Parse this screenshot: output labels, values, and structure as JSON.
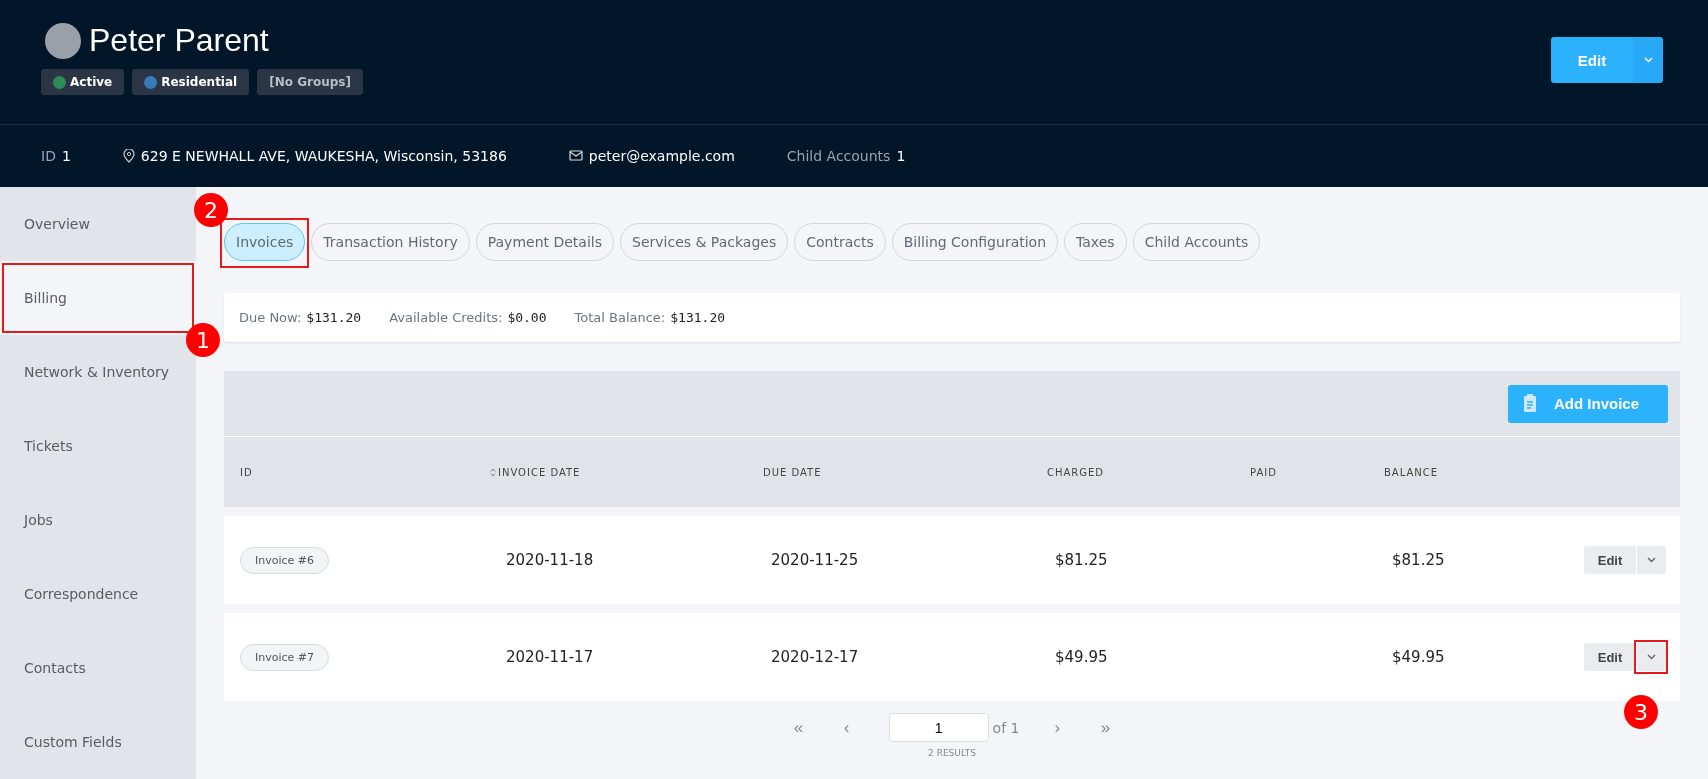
{
  "customer": {
    "name": "Peter Parent",
    "badges": [
      {
        "label": "Active",
        "color": "#2e8b57"
      },
      {
        "label": "Residential",
        "color": "#3a7ab8"
      },
      {
        "label": "[No Groups]"
      }
    ],
    "edit_button": "Edit"
  },
  "info_bar": {
    "id_label": "ID",
    "id_value": "1",
    "address": "629 E NEWHALL AVE, WAUKESHA, Wisconsin, 53186",
    "email": "peter@example.com",
    "child_label": "Child Accounts",
    "child_value": "1"
  },
  "sidebar": {
    "items": [
      {
        "label": "Overview",
        "selected": false
      },
      {
        "label": "Billing",
        "selected": true,
        "callout": "1"
      },
      {
        "label": "Network & Inventory",
        "selected": false
      },
      {
        "label": "Tickets",
        "selected": false
      },
      {
        "label": "Jobs",
        "selected": false
      },
      {
        "label": "Correspondence",
        "selected": false
      },
      {
        "label": "Contacts",
        "selected": false
      },
      {
        "label": "Custom Fields",
        "selected": false
      }
    ]
  },
  "tabs": [
    {
      "label": "Invoices",
      "selected": true,
      "callout": "2"
    },
    {
      "label": "Transaction History",
      "selected": false
    },
    {
      "label": "Payment Details",
      "selected": false
    },
    {
      "label": "Services & Packages",
      "selected": false
    },
    {
      "label": "Contracts",
      "selected": false
    },
    {
      "label": "Billing Configuration",
      "selected": false
    },
    {
      "label": "Taxes",
      "selected": false
    },
    {
      "label": "Child Accounts",
      "selected": false
    }
  ],
  "summary": [
    {
      "label": "Due Now:",
      "value": "$131.20"
    },
    {
      "label": "Available Credits:",
      "value": "$0.00"
    },
    {
      "label": "Total Balance:",
      "value": "$131.20"
    }
  ],
  "table": {
    "add_button": "Add Invoice",
    "columns": [
      "ID",
      "INVOICE DATE",
      "DUE DATE",
      "CHARGED",
      "PAID",
      "BALANCE"
    ],
    "rows": [
      {
        "id": "Invoice #6",
        "invoice_date": "2020-11-18",
        "due_date": "2020-11-25",
        "charged": "$81.25",
        "balance": "$81.25",
        "action": "Edit"
      },
      {
        "id": "Invoice #7",
        "invoice_date": "2020-11-17",
        "due_date": "2020-12-17",
        "charged": "$49.95",
        "balance": "$49.95",
        "action": "Edit",
        "callout": "3"
      }
    ]
  },
  "pagination": {
    "first": "«",
    "prev": "‹",
    "page": "1",
    "of": "of 1",
    "next": "›",
    "last": "»",
    "results": "2 RESULTS"
  }
}
